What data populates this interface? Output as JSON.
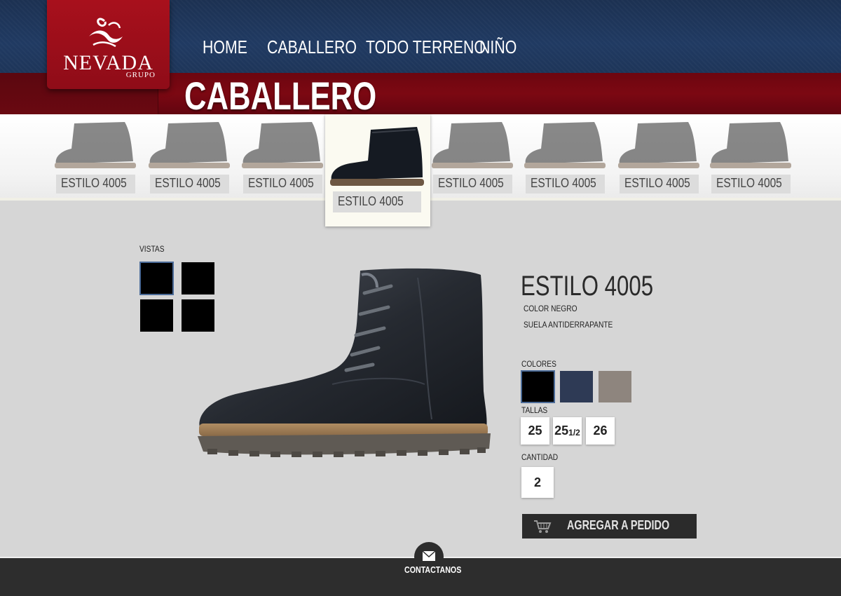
{
  "brand": {
    "name": "NEVADA",
    "sub": "GRUPO"
  },
  "nav": [
    {
      "label": "HOME"
    },
    {
      "label": "CABALLERO"
    },
    {
      "label": "TODO TERRENO"
    },
    {
      "label": "NIÑO"
    }
  ],
  "section_title": "CABALLERO",
  "thumbnails": [
    {
      "label": "ESTILO 4005"
    },
    {
      "label": "ESTILO 4005"
    },
    {
      "label": "ESTILO 4005"
    },
    {
      "label": "ESTILO 4005",
      "active": true
    },
    {
      "label": "ESTILO 4005"
    },
    {
      "label": "ESTILO 4005"
    },
    {
      "label": "ESTILO 4005"
    },
    {
      "label": "ESTILO 4005"
    }
  ],
  "views": {
    "label": "VISTAS"
  },
  "product": {
    "title": "ESTILO 4005",
    "color_spec": "COLOR NEGRO",
    "sole_spec": "SUELA ANTIDERRAPANTE",
    "colors_label": "COLORES",
    "colors": [
      "#000000",
      "#2e3a55",
      "#8e857e"
    ],
    "sizes_label": "TALLAS",
    "sizes": [
      {
        "main": "25",
        "frac": ""
      },
      {
        "main": "25",
        "frac": "1/2"
      },
      {
        "main": "26",
        "frac": ""
      }
    ],
    "quantity_label": "CANTIDAD",
    "quantity": "2",
    "add_button": "AGREGAR A PEDIDO"
  },
  "footer": {
    "contact": "CONTACTANOS"
  }
}
